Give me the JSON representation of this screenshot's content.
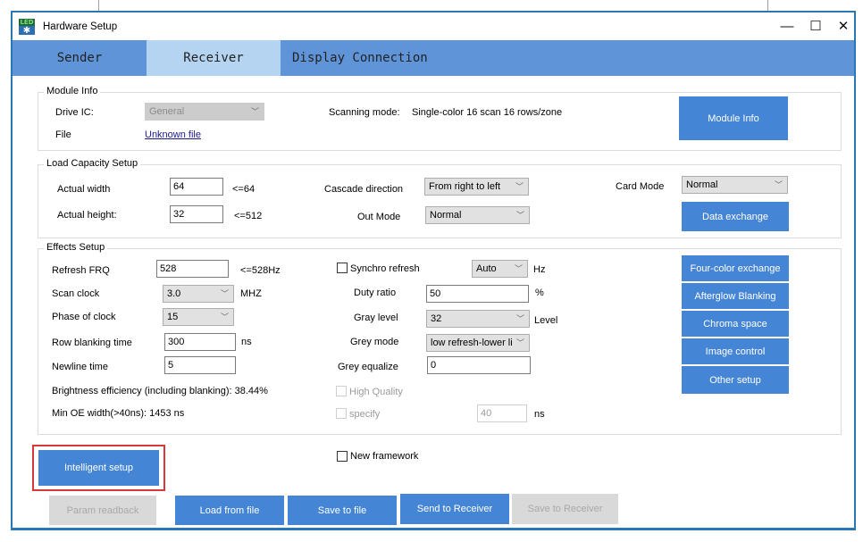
{
  "window": {
    "title": "Hardware Setup",
    "controls": {
      "minimize": "—",
      "maximize": "☐",
      "close": "✕"
    },
    "icon_label": "LED"
  },
  "tabs": [
    {
      "label": "Sender",
      "active": false
    },
    {
      "label": "Receiver",
      "active": true
    },
    {
      "label": "Display Connection",
      "active": false
    }
  ],
  "module_info": {
    "title": "Module Info",
    "drive_ic_label": "Drive IC:",
    "drive_ic_value": "General",
    "file_label": "File",
    "file_link": "Unknown file",
    "scanning_mode_label": "Scanning mode:",
    "scanning_mode_value": "Single-color 16 scan 16 rows/zone",
    "module_info_button": "Module Info"
  },
  "load_capacity": {
    "title": "Load Capacity Setup",
    "actual_width_label": "Actual width",
    "actual_width_value": "64",
    "actual_width_limit": "<=64",
    "actual_height_label": "Actual height:",
    "actual_height_value": "32",
    "actual_height_limit": "<=512",
    "cascade_direction_label": "Cascade direction",
    "cascade_direction_value": "From right to left",
    "out_mode_label": "Out Mode",
    "out_mode_value": "Normal",
    "card_mode_label": "Card Mode",
    "card_mode_value": "Normal",
    "data_exchange_button": "Data exchange"
  },
  "effects": {
    "title": "Effects Setup",
    "refresh_frq_label": "Refresh FRQ",
    "refresh_frq_value": "528",
    "refresh_frq_limit": "<=528Hz",
    "scan_clock_label": "Scan clock",
    "scan_clock_value": "3.0",
    "scan_clock_unit": "MHZ",
    "phase_of_clock_label": "Phase of clock",
    "phase_of_clock_value": "15",
    "row_blanking_label": "Row blanking time",
    "row_blanking_value": "300",
    "row_blanking_unit": "ns",
    "newline_time_label": "Newline time",
    "newline_time_value": "5",
    "brightness_efficiency": "Brightness efficiency (including blanking): 38.44%",
    "min_oe_width": "Min OE width(>40ns): 1453 ns",
    "synchro_refresh_label": "Synchro refresh",
    "synchro_refresh_checked": false,
    "synchro_refresh_value": "Auto",
    "synchro_refresh_unit": "Hz",
    "duty_ratio_label": "Duty ratio",
    "duty_ratio_value": "50",
    "duty_ratio_unit": "%",
    "gray_level_label": "Gray level",
    "gray_level_value": "32",
    "gray_level_unit": "Level",
    "grey_mode_label": "Grey mode",
    "grey_mode_value": "low refresh-lower li",
    "grey_equalize_label": "Grey equalize",
    "grey_equalize_value": "0",
    "high_quality_label": "High Quality",
    "high_quality_checked": false,
    "specify_label": "specify",
    "specify_checked": false,
    "specify_value": "40",
    "specify_unit": "ns",
    "side_buttons": [
      "Four-color exchange",
      "Afterglow Blanking",
      "Chroma space",
      "Image control",
      "Other setup"
    ]
  },
  "bottom": {
    "intelligent_setup": "Intelligent setup",
    "new_framework_label": "New framework",
    "new_framework_checked": false,
    "param_readback": "Param readback",
    "load_from_file": "Load from file",
    "save_to_file": "Save to file",
    "send_to_receiver": "Send to Receiver",
    "save_to_receiver": "Save to Receiver"
  },
  "colors": {
    "accent_button": "#4585d6",
    "tab_bar": "#5f95d8",
    "tab_active": "#b4d4f2",
    "window_border": "#2b77b6",
    "highlight_box": "#d9383a",
    "disabled_button": "#d9d9d9"
  }
}
